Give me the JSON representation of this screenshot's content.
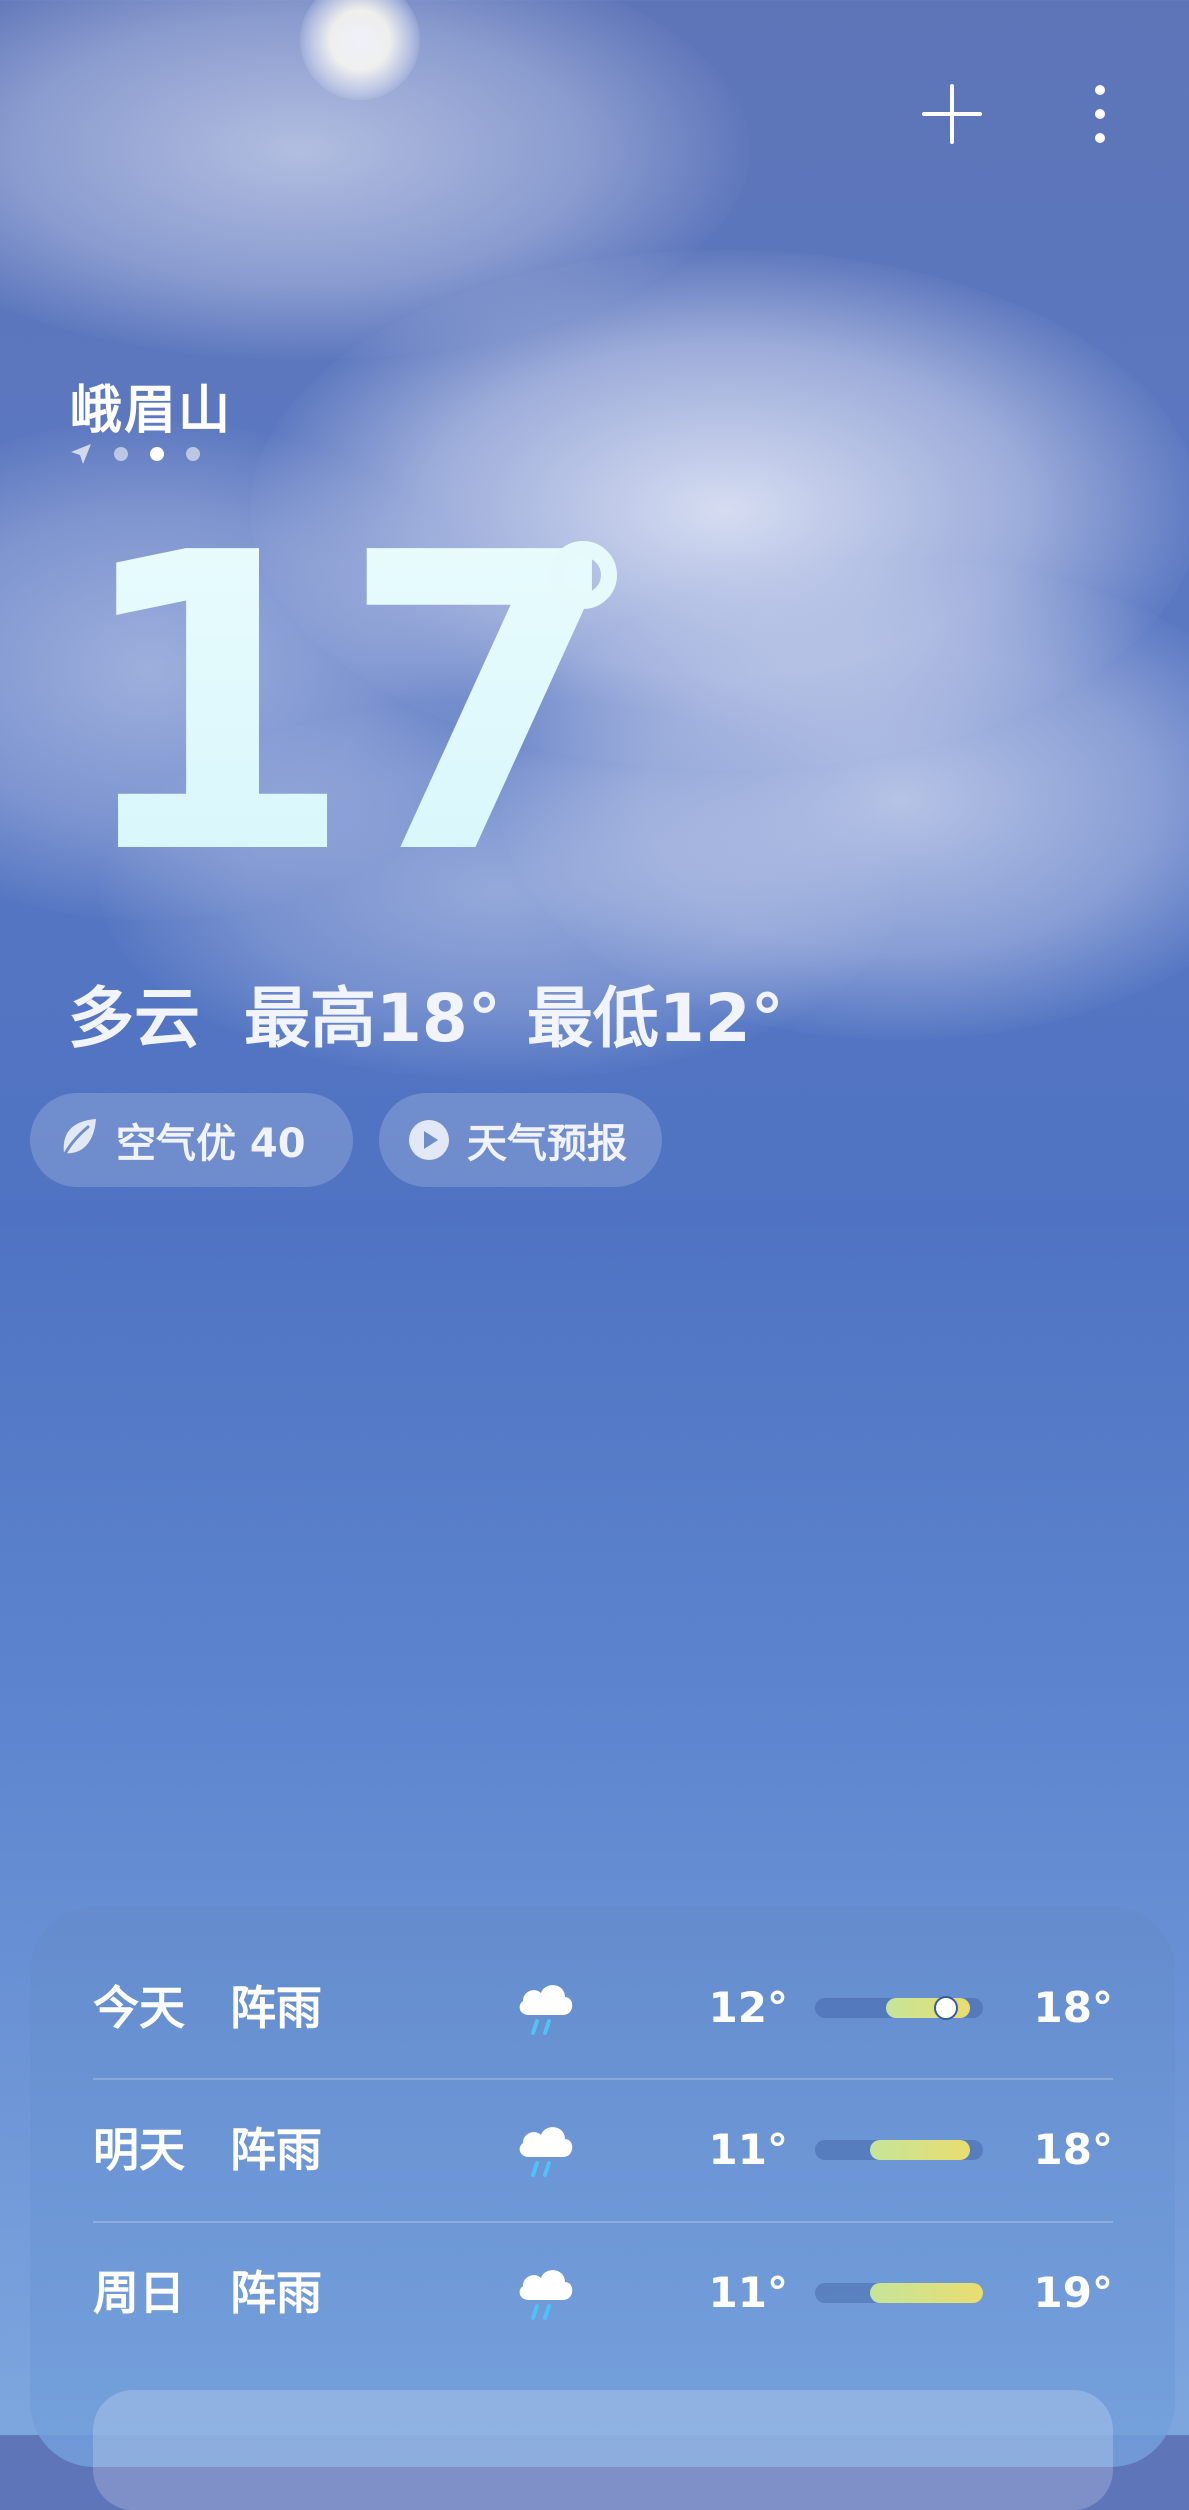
{
  "location": {
    "city": "峨眉山",
    "page_count": 4,
    "active_page": 2
  },
  "current": {
    "temperature": "17",
    "condition": "多云",
    "high": "最高18°",
    "low": "最低12°"
  },
  "chips": {
    "air_quality": "空气优 40",
    "forecast": "天气预报"
  },
  "icons": {
    "add": "plus-icon",
    "menu": "more-vertical-icon",
    "location": "location-arrow-icon",
    "leaf": "leaf-icon",
    "play": "play-circle-icon",
    "rain": "cloud-rain-icon"
  },
  "daily": [
    {
      "day": "今天",
      "condition": "阵雨",
      "low": "12°",
      "high": "18°",
      "range_start": 0.42,
      "range_end": 0.92,
      "current_pos": 0.78
    },
    {
      "day": "明天",
      "condition": "阵雨",
      "low": "11°",
      "high": "18°",
      "range_start": 0.33,
      "range_end": 0.92,
      "current_pos": null
    },
    {
      "day": "周日",
      "condition": "阵雨",
      "low": "11°",
      "high": "19°",
      "range_start": 0.33,
      "range_end": 1.0,
      "current_pos": null
    }
  ],
  "colors": {
    "sky_top": "#5e75b8",
    "sky_bottom": "#7ea6de",
    "range_bar_start": "#c6e59a",
    "range_bar_end": "#e9dd6f",
    "rain_drop": "#4fc3f7"
  }
}
